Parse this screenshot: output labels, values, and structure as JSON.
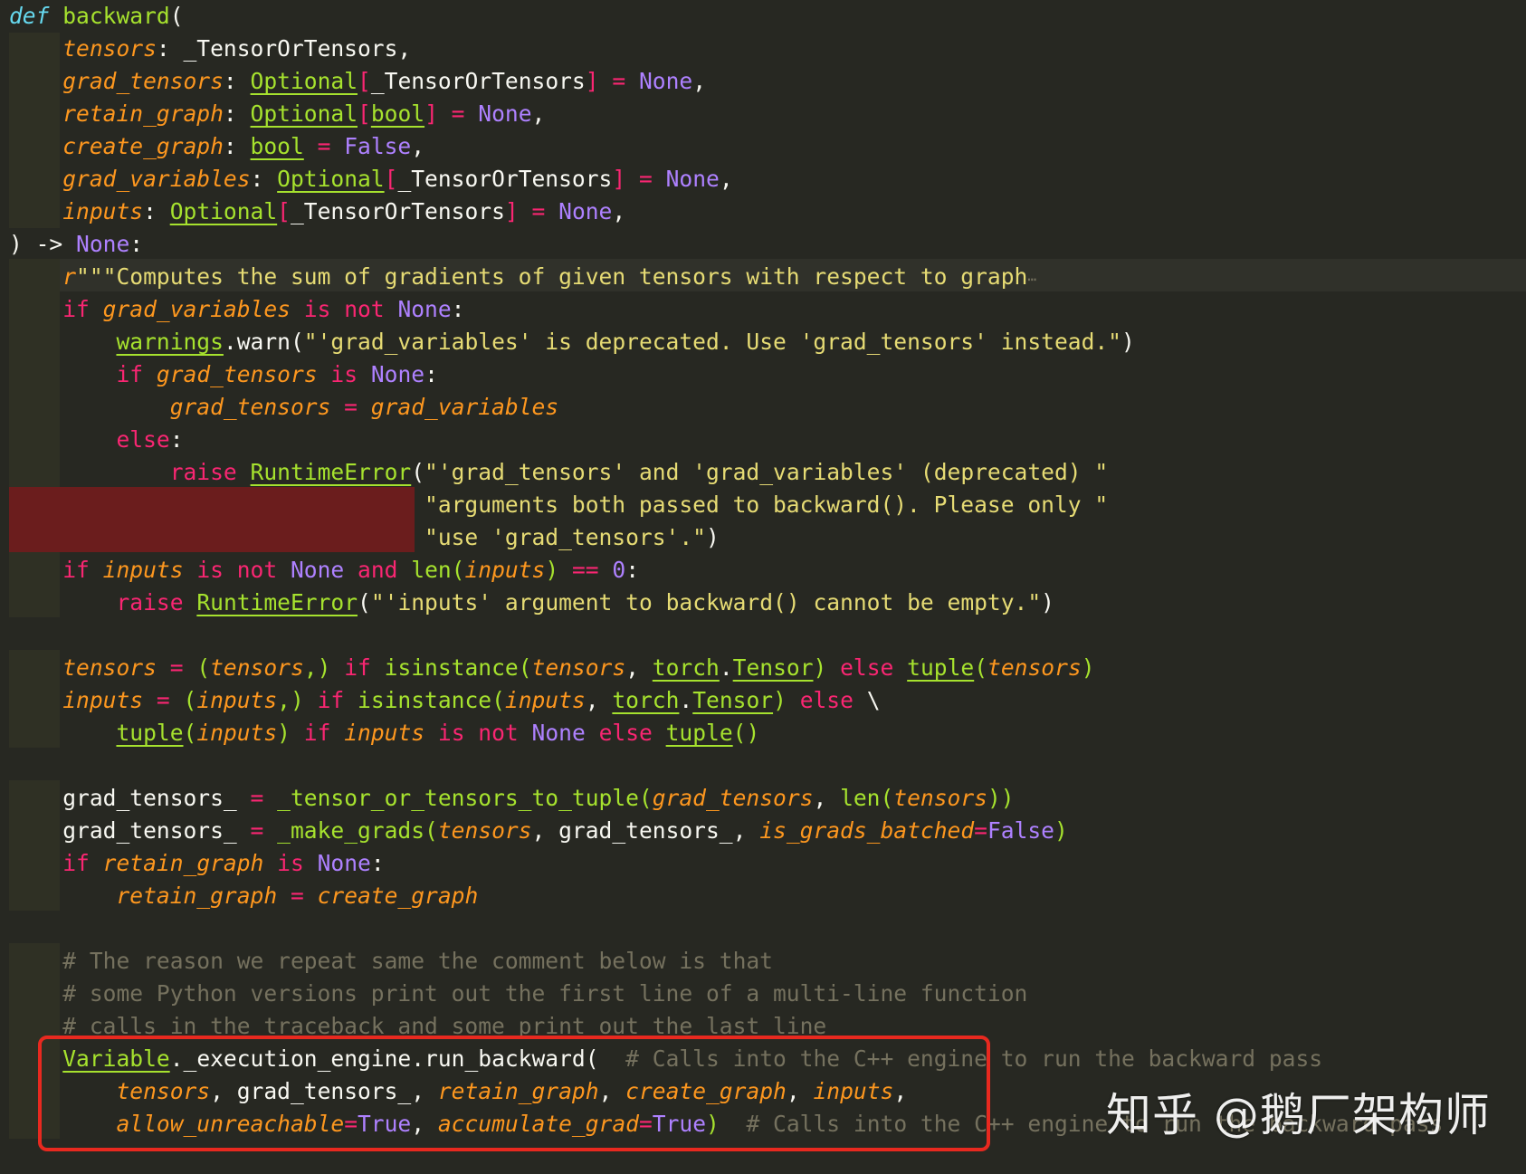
{
  "editor": {
    "lines": [
      [
        {
          "t": "def",
          "c": "def"
        },
        {
          "t": " ",
          "c": "plain"
        },
        {
          "t": "backward",
          "c": "fn"
        },
        {
          "t": "(",
          "c": "plain"
        }
      ],
      [
        {
          "t": "    "
        },
        {
          "t": "tensors",
          "c": "param"
        },
        {
          "t": ": _TensorOrTensors,",
          "c": "plain"
        }
      ],
      [
        {
          "t": "    "
        },
        {
          "t": "grad_tensors",
          "c": "param"
        },
        {
          "t": ": ",
          "c": "plain"
        },
        {
          "t": "Optional",
          "c": "type"
        },
        {
          "t": "[",
          "c": "bracket"
        },
        {
          "t": "_TensorOrTensors",
          "c": "plain"
        },
        {
          "t": "]",
          "c": "bracket"
        },
        {
          "t": " = ",
          "c": "op"
        },
        {
          "t": "None",
          "c": "const"
        },
        {
          "t": ",",
          "c": "plain"
        }
      ],
      [
        {
          "t": "    "
        },
        {
          "t": "retain_graph",
          "c": "param"
        },
        {
          "t": ": ",
          "c": "plain"
        },
        {
          "t": "Optional",
          "c": "type"
        },
        {
          "t": "[",
          "c": "bracket"
        },
        {
          "t": "bool",
          "c": "type"
        },
        {
          "t": "]",
          "c": "bracket"
        },
        {
          "t": " = ",
          "c": "op"
        },
        {
          "t": "None",
          "c": "const"
        },
        {
          "t": ",",
          "c": "plain"
        }
      ],
      [
        {
          "t": "    "
        },
        {
          "t": "create_graph",
          "c": "param"
        },
        {
          "t": ": ",
          "c": "plain"
        },
        {
          "t": "bool",
          "c": "type"
        },
        {
          "t": " = ",
          "c": "op"
        },
        {
          "t": "False",
          "c": "const"
        },
        {
          "t": ",",
          "c": "plain"
        }
      ],
      [
        {
          "t": "    "
        },
        {
          "t": "grad_variables",
          "c": "param"
        },
        {
          "t": ": ",
          "c": "plain"
        },
        {
          "t": "Optional",
          "c": "type"
        },
        {
          "t": "[",
          "c": "bracket"
        },
        {
          "t": "_TensorOrTensors",
          "c": "plain"
        },
        {
          "t": "]",
          "c": "bracket"
        },
        {
          "t": " = ",
          "c": "op"
        },
        {
          "t": "None",
          "c": "const"
        },
        {
          "t": ",",
          "c": "plain"
        }
      ],
      [
        {
          "t": "    "
        },
        {
          "t": "inputs",
          "c": "param"
        },
        {
          "t": ": ",
          "c": "plain"
        },
        {
          "t": "Optional",
          "c": "type"
        },
        {
          "t": "[",
          "c": "bracket"
        },
        {
          "t": "_TensorOrTensors",
          "c": "plain"
        },
        {
          "t": "]",
          "c": "bracket"
        },
        {
          "t": " = ",
          "c": "op"
        },
        {
          "t": "None",
          "c": "const"
        },
        {
          "t": ",",
          "c": "plain"
        }
      ],
      [
        {
          "t": ")",
          "c": "plain"
        },
        {
          "t": " -> ",
          "c": "plain"
        },
        {
          "t": "None",
          "c": "const"
        },
        {
          "t": ":",
          "c": "plain"
        }
      ],
      [
        {
          "t": "    "
        },
        {
          "t": "r",
          "c": "param"
        },
        {
          "t": "\"\"\"Computes the sum of gradients of given tensors with respect to graph",
          "c": "str"
        },
        {
          "t": "⋯",
          "c": "fold"
        }
      ],
      [
        {
          "t": "    "
        },
        {
          "t": "if",
          "c": "kw"
        },
        {
          "t": " "
        },
        {
          "t": "grad_variables",
          "c": "param"
        },
        {
          "t": " is not ",
          "c": "kw"
        },
        {
          "t": "None",
          "c": "const"
        },
        {
          "t": ":",
          "c": "plain"
        }
      ],
      [
        {
          "t": "        "
        },
        {
          "t": "warnings",
          "c": "type"
        },
        {
          "t": ".warn(",
          "c": "plain"
        },
        {
          "t": "\"'grad_variables' is deprecated. Use 'grad_tensors' instead.\"",
          "c": "str"
        },
        {
          "t": ")",
          "c": "plain"
        }
      ],
      [
        {
          "t": "        "
        },
        {
          "t": "if",
          "c": "kw"
        },
        {
          "t": " "
        },
        {
          "t": "grad_tensors",
          "c": "param"
        },
        {
          "t": " is ",
          "c": "kw"
        },
        {
          "t": "None",
          "c": "const"
        },
        {
          "t": ":",
          "c": "plain"
        }
      ],
      [
        {
          "t": "            "
        },
        {
          "t": "grad_tensors",
          "c": "param"
        },
        {
          "t": " = ",
          "c": "op"
        },
        {
          "t": "grad_variables",
          "c": "param"
        }
      ],
      [
        {
          "t": "        "
        },
        {
          "t": "else",
          "c": "kw"
        },
        {
          "t": ":",
          "c": "plain"
        }
      ],
      [
        {
          "t": "            "
        },
        {
          "t": "raise",
          "c": "kw"
        },
        {
          "t": " "
        },
        {
          "t": "RuntimeError",
          "c": "type"
        },
        {
          "t": "(",
          "c": "plain"
        },
        {
          "t": "\"'grad_tensors' and 'grad_variables' (deprecated) \"",
          "c": "str"
        }
      ],
      [
        {
          "t": "                               "
        },
        {
          "t": "\"arguments both passed to backward(). Please only \"",
          "c": "str"
        }
      ],
      [
        {
          "t": "                               "
        },
        {
          "t": "\"use 'grad_tensors'.\"",
          "c": "str"
        },
        {
          "t": ")",
          "c": "plain"
        }
      ],
      [
        {
          "t": "    "
        },
        {
          "t": "if",
          "c": "kw"
        },
        {
          "t": " "
        },
        {
          "t": "inputs",
          "c": "param"
        },
        {
          "t": " is not ",
          "c": "kw"
        },
        {
          "t": "None",
          "c": "const"
        },
        {
          "t": " and ",
          "c": "kw"
        },
        {
          "t": "len(",
          "c": "fn"
        },
        {
          "t": "inputs",
          "c": "param"
        },
        {
          "t": ")",
          "c": "fn"
        },
        {
          "t": " == ",
          "c": "op"
        },
        {
          "t": "0",
          "c": "const"
        },
        {
          "t": ":",
          "c": "plain"
        }
      ],
      [
        {
          "t": "        "
        },
        {
          "t": "raise",
          "c": "kw"
        },
        {
          "t": " "
        },
        {
          "t": "RuntimeError",
          "c": "type"
        },
        {
          "t": "(",
          "c": "plain"
        },
        {
          "t": "\"'inputs' argument to backward() cannot be empty.\"",
          "c": "str"
        },
        {
          "t": ")",
          "c": "plain"
        }
      ],
      [],
      [
        {
          "t": "    "
        },
        {
          "t": "tensors",
          "c": "param"
        },
        {
          "t": " = ",
          "c": "op"
        },
        {
          "t": "(",
          "c": "fn"
        },
        {
          "t": "tensors",
          "c": "param"
        },
        {
          "t": ",) ",
          "c": "fn"
        },
        {
          "t": "if",
          "c": "kw"
        },
        {
          "t": " isinstance(",
          "c": "fn"
        },
        {
          "t": "tensors",
          "c": "param"
        },
        {
          "t": ", ",
          "c": "plain"
        },
        {
          "t": "torch",
          "c": "type"
        },
        {
          "t": ".",
          "c": "plain"
        },
        {
          "t": "Tensor",
          "c": "type"
        },
        {
          "t": ") ",
          "c": "fn"
        },
        {
          "t": "else",
          "c": "kw"
        },
        {
          "t": " "
        },
        {
          "t": "tuple",
          "c": "type"
        },
        {
          "t": "(",
          "c": "fn"
        },
        {
          "t": "tensors",
          "c": "param"
        },
        {
          "t": ")",
          "c": "fn"
        }
      ],
      [
        {
          "t": "    "
        },
        {
          "t": "inputs",
          "c": "param"
        },
        {
          "t": " = ",
          "c": "op"
        },
        {
          "t": "(",
          "c": "fn"
        },
        {
          "t": "inputs",
          "c": "param"
        },
        {
          "t": ",) ",
          "c": "fn"
        },
        {
          "t": "if",
          "c": "kw"
        },
        {
          "t": " isinstance(",
          "c": "fn"
        },
        {
          "t": "inputs",
          "c": "param"
        },
        {
          "t": ", ",
          "c": "plain"
        },
        {
          "t": "torch",
          "c": "type"
        },
        {
          "t": ".",
          "c": "plain"
        },
        {
          "t": "Tensor",
          "c": "type"
        },
        {
          "t": ") ",
          "c": "fn"
        },
        {
          "t": "else",
          "c": "kw"
        },
        {
          "t": " \\",
          "c": "plain"
        }
      ],
      [
        {
          "t": "        "
        },
        {
          "t": "tuple",
          "c": "type"
        },
        {
          "t": "(",
          "c": "fn"
        },
        {
          "t": "inputs",
          "c": "param"
        },
        {
          "t": ") ",
          "c": "fn"
        },
        {
          "t": "if",
          "c": "kw"
        },
        {
          "t": " "
        },
        {
          "t": "inputs",
          "c": "param"
        },
        {
          "t": " is not ",
          "c": "kw"
        },
        {
          "t": "None",
          "c": "const"
        },
        {
          "t": " else ",
          "c": "kw"
        },
        {
          "t": "tuple",
          "c": "type"
        },
        {
          "t": "()",
          "c": "fn"
        }
      ],
      [],
      [
        {
          "t": "    "
        },
        {
          "t": "grad_tensors_",
          "c": "plain"
        },
        {
          "t": " = ",
          "c": "op"
        },
        {
          "t": "_tensor_or_tensors_to_tuple(",
          "c": "fn"
        },
        {
          "t": "grad_tensors",
          "c": "param"
        },
        {
          "t": ", ",
          "c": "plain"
        },
        {
          "t": "len(",
          "c": "fn"
        },
        {
          "t": "tensors",
          "c": "param"
        },
        {
          "t": "))",
          "c": "fn"
        }
      ],
      [
        {
          "t": "    "
        },
        {
          "t": "grad_tensors_",
          "c": "plain"
        },
        {
          "t": " = ",
          "c": "op"
        },
        {
          "t": "_make_grads(",
          "c": "fn"
        },
        {
          "t": "tensors",
          "c": "param"
        },
        {
          "t": ", grad_tensors_, ",
          "c": "plain"
        },
        {
          "t": "is_grads_batched",
          "c": "param"
        },
        {
          "t": "=",
          "c": "op"
        },
        {
          "t": "False",
          "c": "const"
        },
        {
          "t": ")",
          "c": "fn"
        }
      ],
      [
        {
          "t": "    "
        },
        {
          "t": "if",
          "c": "kw"
        },
        {
          "t": " "
        },
        {
          "t": "retain_graph",
          "c": "param"
        },
        {
          "t": " is ",
          "c": "kw"
        },
        {
          "t": "None",
          "c": "const"
        },
        {
          "t": ":",
          "c": "plain"
        }
      ],
      [
        {
          "t": "        "
        },
        {
          "t": "retain_graph",
          "c": "param"
        },
        {
          "t": " = ",
          "c": "op"
        },
        {
          "t": "create_graph",
          "c": "param"
        }
      ],
      [],
      [
        {
          "t": "    "
        },
        {
          "t": "# The reason we repeat same the comment below is that",
          "c": "comment"
        }
      ],
      [
        {
          "t": "    "
        },
        {
          "t": "# some Python versions print out the first line of a multi-line function",
          "c": "comment"
        }
      ],
      [
        {
          "t": "    "
        },
        {
          "t": "# calls in the traceback and some print out the last line",
          "c": "comment"
        }
      ],
      [
        {
          "t": "    "
        },
        {
          "t": "Variable",
          "c": "type"
        },
        {
          "t": "._execution_engine.run_backward(",
          "c": "plain"
        },
        {
          "t": "  # Calls into the C++ engine to run the backward pass",
          "c": "comment"
        }
      ],
      [
        {
          "t": "        "
        },
        {
          "t": "tensors",
          "c": "param"
        },
        {
          "t": ", grad_tensors_, ",
          "c": "plain"
        },
        {
          "t": "retain_graph",
          "c": "param"
        },
        {
          "t": ", ",
          "c": "plain"
        },
        {
          "t": "create_graph",
          "c": "param"
        },
        {
          "t": ", ",
          "c": "plain"
        },
        {
          "t": "inputs",
          "c": "param"
        },
        {
          "t": ",",
          "c": "plain"
        }
      ],
      [
        {
          "t": "        "
        },
        {
          "t": "allow_unreachable",
          "c": "param"
        },
        {
          "t": "=",
          "c": "op"
        },
        {
          "t": "True",
          "c": "const"
        },
        {
          "t": ", ",
          "c": "plain"
        },
        {
          "t": "accumulate_grad",
          "c": "param"
        },
        {
          "t": "=",
          "c": "op"
        },
        {
          "t": "True",
          "c": "const"
        },
        {
          "t": ")",
          "c": "fn"
        },
        {
          "t": "  # Calls into the C++ engine to run the backward pass",
          "c": "comment"
        }
      ]
    ]
  },
  "watermark": "知乎 @鹅厂架构师",
  "colors": {
    "background": "#272822",
    "highlight_box": "#e8291f",
    "error_block": "#6b1d1d"
  }
}
